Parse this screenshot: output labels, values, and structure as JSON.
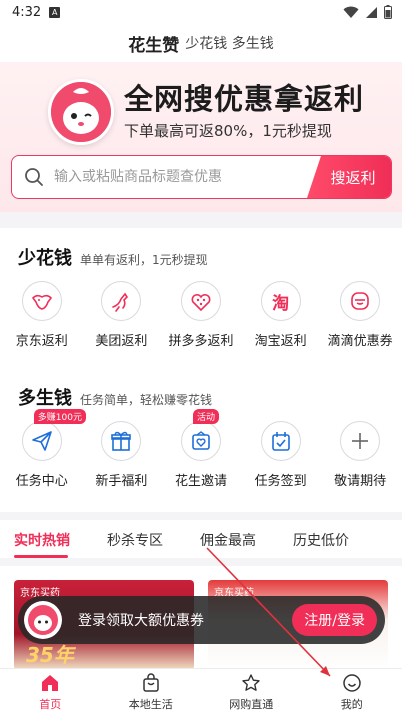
{
  "status_bar": {
    "time": "4:32",
    "notification_glyph": "A"
  },
  "header": {
    "brand": "花生赞",
    "slogan": "少花钱 多生钱"
  },
  "hero": {
    "headline": "全网搜优惠拿返利",
    "subline": "下单最高可返80%，1元秒提现"
  },
  "search": {
    "placeholder": "输入或粘贴商品标题查优惠",
    "button_label": "搜返利"
  },
  "save_money": {
    "title": "少花钱",
    "subtitle": "单单有返利，1元秒提现",
    "items": [
      {
        "label": "京东返利",
        "icon": "jd-dog-icon"
      },
      {
        "label": "美团返利",
        "icon": "meituan-kangaroo-icon"
      },
      {
        "label": "拼多多返利",
        "icon": "pinduoduo-icon"
      },
      {
        "label": "淘宝返利",
        "icon": "taobao-icon"
      },
      {
        "label": "滴滴优惠券",
        "icon": "didi-icon"
      }
    ]
  },
  "earn_money": {
    "title": "多生钱",
    "subtitle": "任务简单，轻松赚零花钱",
    "items": [
      {
        "label": "任务中心",
        "icon": "paper-plane-icon",
        "badge": "多赚100元"
      },
      {
        "label": "新手福利",
        "icon": "gift-icon",
        "badge": ""
      },
      {
        "label": "花生邀请",
        "icon": "invite-heart-icon",
        "badge": "活动"
      },
      {
        "label": "任务签到",
        "icon": "calendar-check-icon",
        "badge": ""
      },
      {
        "label": "敬请期待",
        "icon": "plus-icon",
        "badge": ""
      }
    ]
  },
  "tabs": [
    {
      "label": "实时热销",
      "active": true
    },
    {
      "label": "秒杀专区",
      "active": false
    },
    {
      "label": "佣金最高",
      "active": false
    },
    {
      "label": "历史低价",
      "active": false
    }
  ],
  "products": [
    {
      "brand": "京东买药",
      "promo": "35年"
    },
    {
      "brand": "京东买药",
      "promo": ""
    }
  ],
  "toast": {
    "message": "登录领取大额优惠券",
    "button_label": "注册/登录"
  },
  "bottom_nav": [
    {
      "label": "首页",
      "icon": "home-icon",
      "active": true
    },
    {
      "label": "本地生活",
      "icon": "shopping-bag-icon",
      "active": false
    },
    {
      "label": "网购直通",
      "icon": "star-icon",
      "active": false
    },
    {
      "label": "我的",
      "icon": "smiley-profile-icon",
      "active": false
    }
  ],
  "colors": {
    "accent": "#f02e57",
    "hero_bg": "#fde7ea"
  }
}
